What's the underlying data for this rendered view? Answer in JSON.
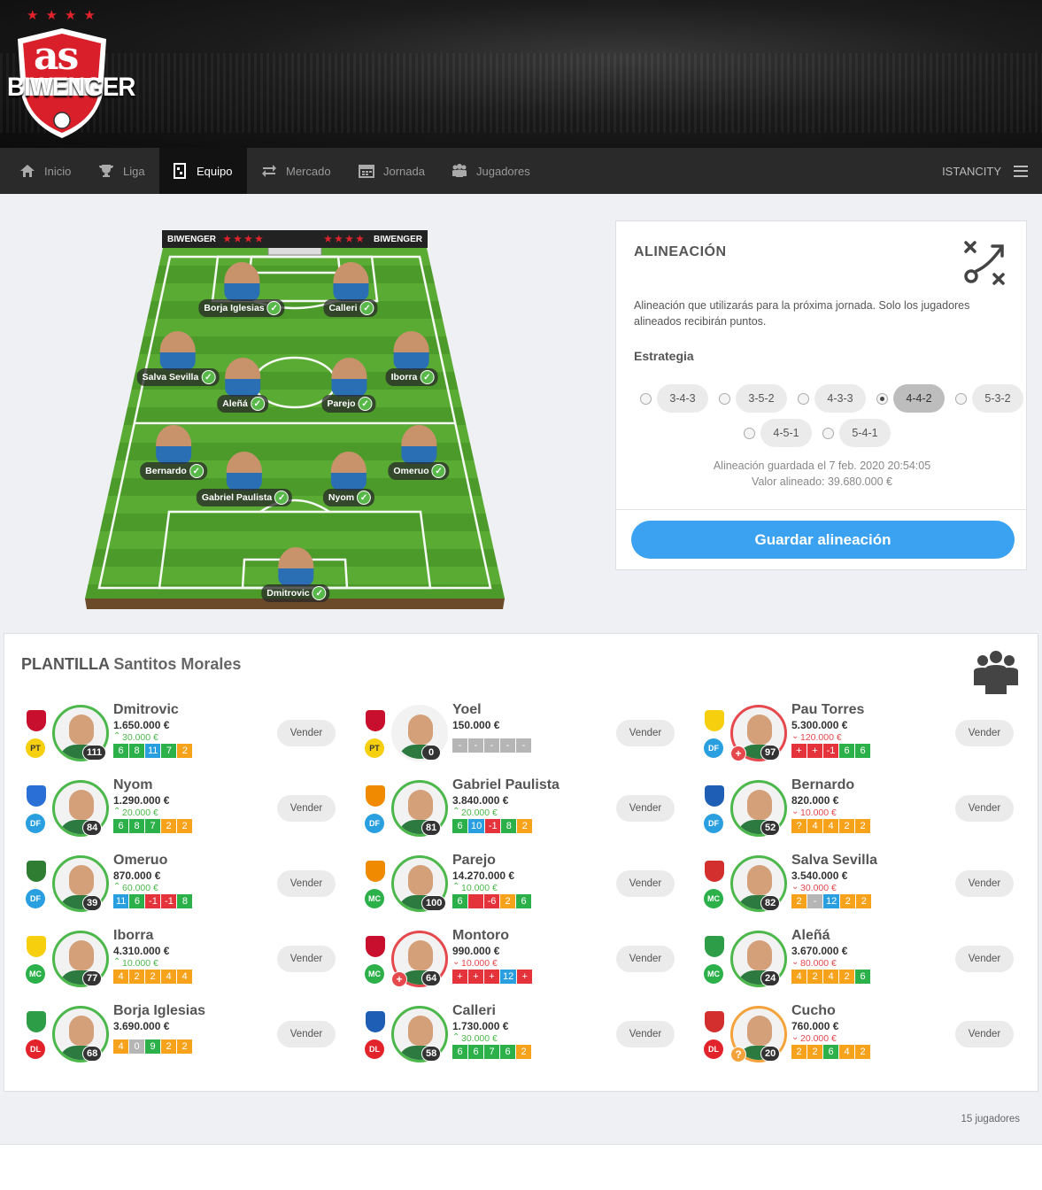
{
  "brand": {
    "logo_prefix": "as",
    "logo_text": "BIWENGER"
  },
  "nav": {
    "items": [
      {
        "label": "Inicio",
        "icon": "home-icon"
      },
      {
        "label": "Liga",
        "icon": "trophy-icon"
      },
      {
        "label": "Equipo",
        "icon": "lineup-icon",
        "active": true
      },
      {
        "label": "Mercado",
        "icon": "transfer-icon"
      },
      {
        "label": "Jornada",
        "icon": "calendar-icon"
      },
      {
        "label": "Jugadores",
        "icon": "players-icon"
      }
    ],
    "user": "ISTANCITY"
  },
  "pitch": {
    "brand_left": "BIWENGER",
    "brand_right": "BIWENGER",
    "players": [
      "Borja Iglesias",
      "Calleri",
      "Salva Sevilla",
      "Aleñá",
      "Parejo",
      "Iborra",
      "Bernardo",
      "Gabriel Paulista",
      "Nyom",
      "Omeruo",
      "Dmitrovic"
    ]
  },
  "lineup": {
    "title": "ALINEACIÓN",
    "description": "Alineación que utilizarás para la próxima jornada. Solo los jugadores alineados recibirán puntos.",
    "strategy_label": "Estrategia",
    "formations": [
      "3-4-3",
      "3-5-2",
      "4-3-3",
      "4-4-2",
      "5-3-2",
      "4-5-1",
      "5-4-1"
    ],
    "selected": "4-4-2",
    "saved_text": "Alineación guardada el 7 feb. 2020 20:54:05",
    "value_text": "Valor alineado: 39.680.000 €",
    "save_button": "Guardar alineación"
  },
  "squad": {
    "title": "PLANTILLA",
    "team": "Santitos Morales",
    "sell_label": "Vender",
    "count_text": "15 jugadores",
    "players": [
      {
        "name": "Dmitrovic",
        "price": "1.650.000 €",
        "delta": "30.000 €",
        "trend": "up",
        "pos": "PT",
        "points": "111",
        "ring": "green",
        "crest": "#c8102e",
        "status": "",
        "scores": [
          [
            "6",
            "g"
          ],
          [
            "8",
            "g"
          ],
          [
            "11",
            "b"
          ],
          [
            "7",
            "g"
          ],
          [
            "2",
            "o"
          ]
        ]
      },
      {
        "name": "Yoel",
        "price": "150.000 €",
        "delta": "",
        "trend": "",
        "pos": "PT",
        "points": "0",
        "ring": "none",
        "crest": "#c8102e",
        "status": "",
        "scores": [
          [
            "-",
            "x"
          ],
          [
            "-",
            "x"
          ],
          [
            "-",
            "x"
          ],
          [
            "-",
            "x"
          ],
          [
            "-",
            "x"
          ]
        ]
      },
      {
        "name": "Pau Torres",
        "price": "5.300.000 €",
        "delta": "120.000 €",
        "trend": "down",
        "pos": "DF",
        "points": "97",
        "ring": "red",
        "crest": "#f6cf0f",
        "status": "+",
        "scores": [
          [
            "+",
            "r"
          ],
          [
            "+",
            "r"
          ],
          [
            "-1",
            "r"
          ],
          [
            "6",
            "g"
          ],
          [
            "6",
            "g"
          ]
        ]
      },
      {
        "name": "Nyom",
        "price": "1.290.000 €",
        "delta": "20.000 €",
        "trend": "up",
        "pos": "DF",
        "points": "84",
        "ring": "green",
        "crest": "#2a6fd6",
        "status": "",
        "scores": [
          [
            "6",
            "g"
          ],
          [
            "8",
            "g"
          ],
          [
            "7",
            "g"
          ],
          [
            "2",
            "o"
          ],
          [
            "2",
            "o"
          ]
        ]
      },
      {
        "name": "Gabriel Paulista",
        "price": "3.840.000 €",
        "delta": "20.000 €",
        "trend": "up",
        "pos": "DF",
        "points": "81",
        "ring": "green",
        "crest": "#f08a00",
        "status": "",
        "scores": [
          [
            "6",
            "g"
          ],
          [
            "10",
            "b"
          ],
          [
            "-1",
            "r"
          ],
          [
            "8",
            "g"
          ],
          [
            "2",
            "o"
          ]
        ]
      },
      {
        "name": "Bernardo",
        "price": "820.000 €",
        "delta": "10.000 €",
        "trend": "down",
        "pos": "DF",
        "points": "52",
        "ring": "green",
        "crest": "#1e5eb5",
        "status": "",
        "scores": [
          [
            "?",
            "o"
          ],
          [
            "4",
            "o"
          ],
          [
            "4",
            "o"
          ],
          [
            "2",
            "o"
          ],
          [
            "2",
            "o"
          ]
        ]
      },
      {
        "name": "Omeruo",
        "price": "870.000 €",
        "delta": "60.000 €",
        "trend": "up",
        "pos": "DF",
        "points": "39",
        "ring": "green",
        "crest": "#2e7d32",
        "status": "",
        "scores": [
          [
            "11",
            "b"
          ],
          [
            "6",
            "g"
          ],
          [
            "-1",
            "r"
          ],
          [
            "-1",
            "r"
          ],
          [
            "8",
            "g"
          ]
        ]
      },
      {
        "name": "Parejo",
        "price": "14.270.000 €",
        "delta": "10.000 €",
        "trend": "up",
        "pos": "MC",
        "points": "100",
        "ring": "green",
        "crest": "#f08a00",
        "status": "",
        "scores": [
          [
            "6",
            "g"
          ],
          [
            "",
            "r"
          ],
          [
            "-6",
            "r"
          ],
          [
            "2",
            "o"
          ],
          [
            "6",
            "g"
          ]
        ]
      },
      {
        "name": "Salva Sevilla",
        "price": "3.540.000 €",
        "delta": "30.000 €",
        "trend": "down",
        "pos": "MC",
        "points": "82",
        "ring": "green",
        "crest": "#d32f2f",
        "status": "",
        "scores": [
          [
            "2",
            "o"
          ],
          [
            "-",
            "x"
          ],
          [
            "12",
            "b"
          ],
          [
            "2",
            "o"
          ],
          [
            "2",
            "o"
          ]
        ]
      },
      {
        "name": "Iborra",
        "price": "4.310.000 €",
        "delta": "10.000 €",
        "trend": "up",
        "pos": "MC",
        "points": "77",
        "ring": "green",
        "crest": "#f6cf0f",
        "status": "",
        "scores": [
          [
            "4",
            "o"
          ],
          [
            "2",
            "o"
          ],
          [
            "2",
            "o"
          ],
          [
            "4",
            "o"
          ],
          [
            "4",
            "o"
          ]
        ]
      },
      {
        "name": "Montoro",
        "price": "990.000 €",
        "delta": "10.000 €",
        "trend": "down",
        "pos": "MC",
        "points": "64",
        "ring": "red",
        "crest": "#c8102e",
        "status": "+",
        "scores": [
          [
            "+",
            "r"
          ],
          [
            "+",
            "r"
          ],
          [
            "+",
            "r"
          ],
          [
            "12",
            "b"
          ],
          [
            "+",
            "r"
          ]
        ]
      },
      {
        "name": "Aleñá",
        "price": "3.670.000 €",
        "delta": "80.000 €",
        "trend": "down",
        "pos": "MC",
        "points": "24",
        "ring": "green",
        "crest": "#2e9d48",
        "status": "",
        "scores": [
          [
            "4",
            "o"
          ],
          [
            "2",
            "o"
          ],
          [
            "4",
            "o"
          ],
          [
            "2",
            "o"
          ],
          [
            "6",
            "g"
          ]
        ]
      },
      {
        "name": "Borja Iglesias",
        "price": "3.690.000 €",
        "delta": "",
        "trend": "",
        "pos": "DL",
        "points": "68",
        "ring": "green",
        "crest": "#2e9d48",
        "status": "",
        "scores": [
          [
            "4",
            "o"
          ],
          [
            "0",
            "x"
          ],
          [
            "9",
            "g"
          ],
          [
            "2",
            "o"
          ],
          [
            "2",
            "o"
          ]
        ]
      },
      {
        "name": "Calleri",
        "price": "1.730.000 €",
        "delta": "30.000 €",
        "trend": "up",
        "pos": "DL",
        "points": "58",
        "ring": "green",
        "crest": "#1e5eb5",
        "status": "",
        "scores": [
          [
            "6",
            "g"
          ],
          [
            "6",
            "g"
          ],
          [
            "7",
            "g"
          ],
          [
            "6",
            "g"
          ],
          [
            "2",
            "o"
          ]
        ]
      },
      {
        "name": "Cucho",
        "price": "760.000 €",
        "delta": "20.000 €",
        "trend": "down",
        "pos": "DL",
        "points": "20",
        "ring": "orange",
        "crest": "#d32f2f",
        "status": "?",
        "scores": [
          [
            "2",
            "o"
          ],
          [
            "2",
            "o"
          ],
          [
            "6",
            "g"
          ],
          [
            "4",
            "o"
          ],
          [
            "2",
            "o"
          ]
        ]
      }
    ]
  }
}
